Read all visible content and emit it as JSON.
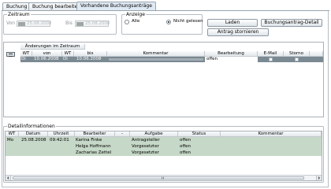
{
  "tabs": [
    {
      "label": "Buchung"
    },
    {
      "label": "Buchung bearbeiten"
    },
    {
      "label": "Vorhandene Buchungsanträge"
    }
  ],
  "zeitraum": {
    "legend": "Zeitraum",
    "von_label": "Von",
    "von_value": "25.08.2008",
    "bis_label": "Bis",
    "bis_value": "25.08.2008"
  },
  "anzeige": {
    "legend": "Anzeige",
    "options": [
      {
        "label": "Alle",
        "selected": false
      },
      {
        "label": "Nicht gelesen",
        "selected": true
      }
    ]
  },
  "buttons": {
    "laden": "Laden",
    "detail": "Buchungsantrag-Detail",
    "stornieren": "Antrag stornieren"
  },
  "changes_table": {
    "group_header": "Änderungen im Zeitraum",
    "columns": [
      "WT",
      "von",
      "WT",
      "bis",
      "Kommentar",
      "Bearbeitung",
      "E-Mail",
      "Storno"
    ],
    "rows": [
      {
        "wt1": "Di",
        "von": "10.06.2008",
        "wt2": "Di",
        "bis": "10.06.2008",
        "kommentar": "",
        "bearbeitung": "offen",
        "email": false,
        "storno": false
      }
    ]
  },
  "details": {
    "legend": "Detailinformationen",
    "columns": [
      "WT",
      "Datum",
      "Uhrzeit",
      "Bearbeiter",
      "-",
      "Aufgabe",
      "Status",
      "Kommentar"
    ],
    "rows": [
      {
        "wt": "Mo",
        "datum": "25.08.2008",
        "uhrzeit": "09:42:01",
        "bearbeiter": "Karina Finke",
        "dash": "",
        "aufgabe": "Antragsteller",
        "status": "offen",
        "kommentar": ""
      },
      {
        "wt": "",
        "datum": "",
        "uhrzeit": "",
        "bearbeiter": "Helga Hoffmann",
        "dash": "",
        "aufgabe": "Vorgesetzter",
        "status": "offen",
        "kommentar": ""
      },
      {
        "wt": "",
        "datum": "",
        "uhrzeit": "",
        "bearbeiter": "Zacharias Zettel",
        "dash": "",
        "aufgabe": "Vorgesetzter",
        "status": "offen",
        "kommentar": ""
      }
    ]
  }
}
